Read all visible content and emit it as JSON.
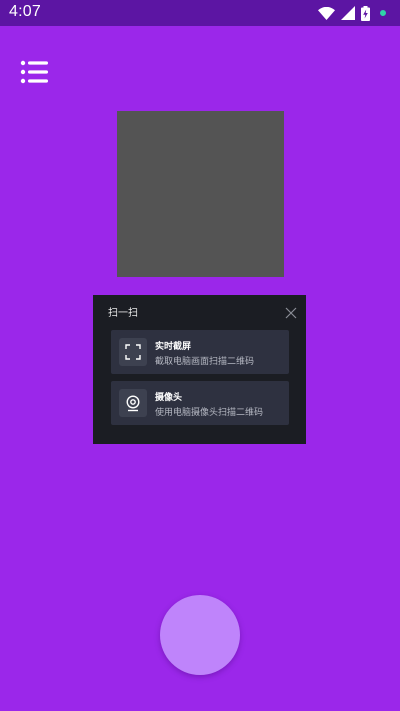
{
  "status_bar": {
    "time": "4:07",
    "icons": [
      "wifi-icon",
      "signal-icon",
      "battery-charging-icon",
      "notification-dot-icon"
    ]
  },
  "toolbar": {
    "menu_icon": "menu-list-icon"
  },
  "scan_dialog": {
    "title": "扫一扫",
    "close_icon": "close-icon",
    "options": [
      {
        "icon": "screen-scan-icon",
        "title": "实时截屏",
        "description": "截取电脑画面扫描二维码"
      },
      {
        "icon": "webcam-icon",
        "title": "摄像头",
        "description": "使用电脑摄像头扫描二维码"
      }
    ]
  },
  "colors": {
    "background": "#9b27ea",
    "status_bar": "#5c15a3",
    "dialog": "#1b1d23",
    "option": "#2e3140",
    "capture_button": "#bf84fb",
    "preview": "#545454"
  }
}
